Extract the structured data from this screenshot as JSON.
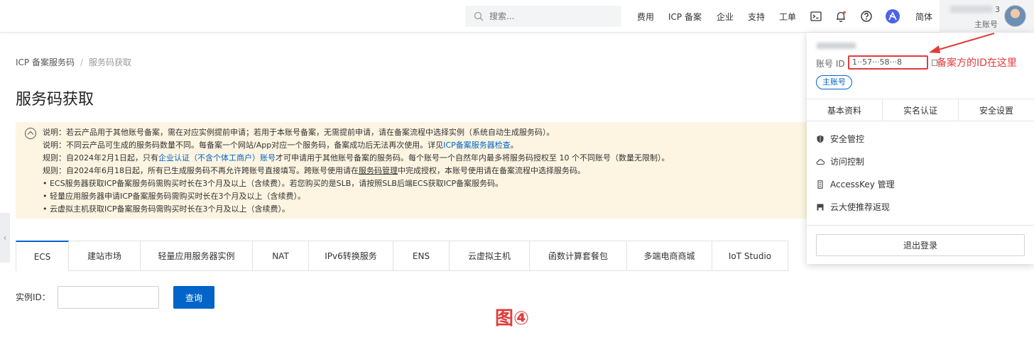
{
  "topbar": {
    "search_placeholder": "搜索...",
    "nav": [
      "费用",
      "ICP 备案",
      "企业",
      "支持",
      "工单"
    ],
    "lang": "简体",
    "user_suffix": "3",
    "user_role": "主账号"
  },
  "breadcrumb": {
    "root": "ICP 备案服务码",
    "sep": "/",
    "current": "服务码获取"
  },
  "page": {
    "title": "服务码获取"
  },
  "notice": {
    "l1": "说明：若云产品用于其他账号备案，需在对应实例提前申请；若用于本账号备案，无需提前申请，请在备案流程中选择实例（系统自动生成服务码）。",
    "l2_a": "说明：不同云产品可生成的服务码数量不同。每备案一个网站/App对应一个服务码，备案成功后无法再次使用。详见",
    "l2_link": "ICP备案服务器检查",
    "l2_b": "。",
    "l3_a": "规则：自2024年2月1日起，只有",
    "l3_link": "企业认证（不含个体工商户）账号",
    "l3_b": "才可申请用于其他账号备案的服务码。每个账号一个自然年内最多将服务码授权至 10 个不同账号（数量无限制）。",
    "l4_a": "规则：自2024年6月18日起，所有已生成服务码不再允许跨账号直接填写。跨账号使用请在",
    "l4_link": "服务码管理",
    "l4_b": "中完成授权，本账号使用请在备案流程中选择服务码。",
    "l5": "• ECS服务器获取ICP备案服务码需购买时长在3个月及以上（含续费）。若您购买的是SLB，请按照SLB后端ECS获取ICP备案服务码。",
    "l6": "• 轻量应用服务器申请ICP备案服务码需购买时长在3个月及以上（含续费）。",
    "l7": "• 云虚拟主机获取ICP备案服务码需购买时长在3个月及以上（含续费）。"
  },
  "tabs": [
    "ECS",
    "建站市场",
    "轻量应用服务器实例",
    "NAT",
    "IPv6转换服务",
    "ENS",
    "云虚拟主机",
    "函数计算套餐包",
    "多端电商商城",
    "IoT Studio"
  ],
  "form": {
    "instance_label": "实例ID：",
    "query_label": "查询"
  },
  "figure_label": "图④",
  "panel": {
    "account_id_label": "账号 ID",
    "account_id_value": "1··57···58···8",
    "annotation": "备案方的ID在这里",
    "main_badge": "主账号",
    "tabs": [
      "基本资料",
      "实名认证",
      "安全设置"
    ],
    "menu": [
      {
        "label": "安全管控",
        "icon": "shield-icon"
      },
      {
        "label": "访问控制",
        "icon": "cloud-icon"
      },
      {
        "label": "AccessKey 管理",
        "icon": "key-icon"
      },
      {
        "label": "云大使推荐返现",
        "icon": "gift-icon"
      }
    ],
    "logout": "退出登录"
  },
  "colors": {
    "accent": "#0064c8",
    "notice_bg": "#fdf5e2",
    "annotation_red": "#e23b3b"
  }
}
